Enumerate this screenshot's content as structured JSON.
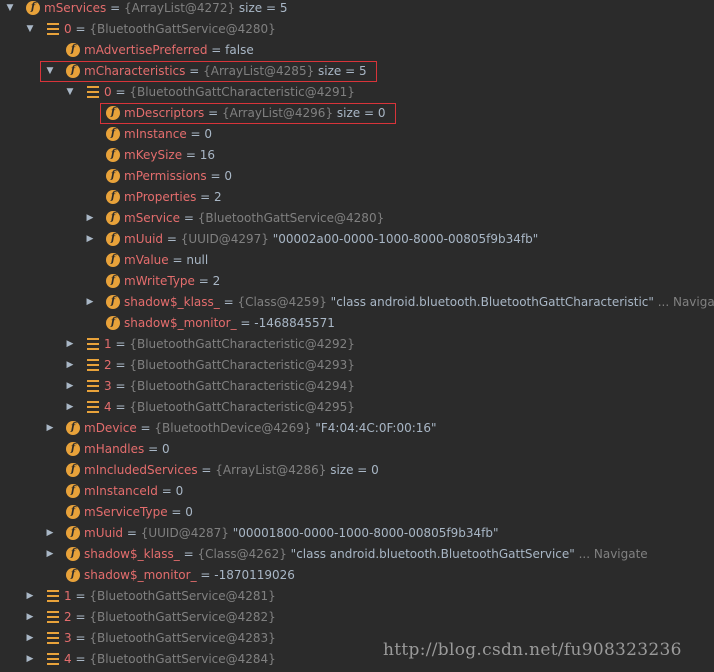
{
  "rows": [
    {
      "depth": 0,
      "arrow": "down",
      "icon": "f",
      "name": "mServices",
      "ref": "{ArrayList@4272}",
      "value": "size = 5"
    },
    {
      "depth": 1,
      "arrow": "down",
      "icon": "list",
      "name": "0",
      "ref": "{BluetoothGattService@4280}",
      "value": ""
    },
    {
      "depth": 2,
      "arrow": "",
      "icon": "f",
      "name": "mAdvertisePreferred",
      "ref": "",
      "value": "false"
    },
    {
      "depth": 2,
      "arrow": "down",
      "icon": "f",
      "name": "mCharacteristics",
      "ref": "{ArrayList@4285}",
      "value": "size = 5"
    },
    {
      "depth": 3,
      "arrow": "down",
      "icon": "list",
      "name": "0",
      "ref": "{BluetoothGattCharacteristic@4291}",
      "value": ""
    },
    {
      "depth": 4,
      "arrow": "",
      "icon": "f",
      "name": "mDescriptors",
      "ref": "{ArrayList@4296}",
      "value": "size = 0"
    },
    {
      "depth": 4,
      "arrow": "",
      "icon": "f",
      "name": "mInstance",
      "ref": "",
      "value": "0"
    },
    {
      "depth": 4,
      "arrow": "",
      "icon": "f",
      "name": "mKeySize",
      "ref": "",
      "value": "16"
    },
    {
      "depth": 4,
      "arrow": "",
      "icon": "f",
      "name": "mPermissions",
      "ref": "",
      "value": "0"
    },
    {
      "depth": 4,
      "arrow": "",
      "icon": "f",
      "name": "mProperties",
      "ref": "",
      "value": "2"
    },
    {
      "depth": 4,
      "arrow": "right",
      "icon": "f",
      "name": "mService",
      "ref": "{BluetoothGattService@4280}",
      "value": ""
    },
    {
      "depth": 4,
      "arrow": "right",
      "icon": "f",
      "name": "mUuid",
      "ref": "{UUID@4297}",
      "value": "\"00002a00-0000-1000-8000-00805f9b34fb\""
    },
    {
      "depth": 4,
      "arrow": "",
      "icon": "f",
      "name": "mValue",
      "ref": "",
      "value": "null"
    },
    {
      "depth": 4,
      "arrow": "",
      "icon": "f",
      "name": "mWriteType",
      "ref": "",
      "value": "2"
    },
    {
      "depth": 4,
      "arrow": "right",
      "icon": "f",
      "name": "shadow$_klass_",
      "ref": "{Class@4259}",
      "value": "\"class android.bluetooth.BluetoothGattCharacteristic\"",
      "nav": "... Navigate"
    },
    {
      "depth": 4,
      "arrow": "",
      "icon": "f",
      "name": "shadow$_monitor_",
      "ref": "",
      "value": "-1468845571"
    },
    {
      "depth": 3,
      "arrow": "right",
      "icon": "list",
      "name": "1",
      "ref": "{BluetoothGattCharacteristic@4292}",
      "value": ""
    },
    {
      "depth": 3,
      "arrow": "right",
      "icon": "list",
      "name": "2",
      "ref": "{BluetoothGattCharacteristic@4293}",
      "value": ""
    },
    {
      "depth": 3,
      "arrow": "right",
      "icon": "list",
      "name": "3",
      "ref": "{BluetoothGattCharacteristic@4294}",
      "value": ""
    },
    {
      "depth": 3,
      "arrow": "right",
      "icon": "list",
      "name": "4",
      "ref": "{BluetoothGattCharacteristic@4295}",
      "value": ""
    },
    {
      "depth": 2,
      "arrow": "right",
      "icon": "f",
      "name": "mDevice",
      "ref": "{BluetoothDevice@4269}",
      "value": "\"F4:04:4C:0F:00:16\""
    },
    {
      "depth": 2,
      "arrow": "",
      "icon": "f",
      "name": "mHandles",
      "ref": "",
      "value": "0"
    },
    {
      "depth": 2,
      "arrow": "",
      "icon": "f",
      "name": "mIncludedServices",
      "ref": "{ArrayList@4286}",
      "value": "size = 0"
    },
    {
      "depth": 2,
      "arrow": "",
      "icon": "f",
      "name": "mInstanceId",
      "ref": "",
      "value": "0"
    },
    {
      "depth": 2,
      "arrow": "",
      "icon": "f",
      "name": "mServiceType",
      "ref": "",
      "value": "0"
    },
    {
      "depth": 2,
      "arrow": "right",
      "icon": "f",
      "name": "mUuid",
      "ref": "{UUID@4287}",
      "value": "\"00001800-0000-1000-8000-00805f9b34fb\""
    },
    {
      "depth": 2,
      "arrow": "right",
      "icon": "f",
      "name": "shadow$_klass_",
      "ref": "{Class@4262}",
      "value": "\"class android.bluetooth.BluetoothGattService\"",
      "nav": "... Navigate"
    },
    {
      "depth": 2,
      "arrow": "",
      "icon": "f",
      "name": "shadow$_monitor_",
      "ref": "",
      "value": "-1870119026"
    },
    {
      "depth": 1,
      "arrow": "right",
      "icon": "list",
      "name": "1",
      "ref": "{BluetoothGattService@4281}",
      "value": ""
    },
    {
      "depth": 1,
      "arrow": "right",
      "icon": "list",
      "name": "2",
      "ref": "{BluetoothGattService@4282}",
      "value": ""
    },
    {
      "depth": 1,
      "arrow": "right",
      "icon": "list",
      "name": "3",
      "ref": "{BluetoothGattService@4283}",
      "value": ""
    },
    {
      "depth": 1,
      "arrow": "right",
      "icon": "list",
      "name": "4",
      "ref": "{BluetoothGattService@4284}",
      "value": ""
    }
  ],
  "icons": {
    "f": "field-icon",
    "list": "list-item-icon",
    "down": "expanded-arrow-icon",
    "right": "collapsed-arrow-icon"
  },
  "highlights": [
    3,
    5
  ],
  "colors": {
    "background": "#2b2b2b",
    "field_name": "#e46d6d",
    "reference": "#808080",
    "value": "#a9b7c6",
    "field_icon": "#e8a23a",
    "highlight": "#d8343a"
  },
  "watermark": "http://blog.csdn.net/fu908323236"
}
